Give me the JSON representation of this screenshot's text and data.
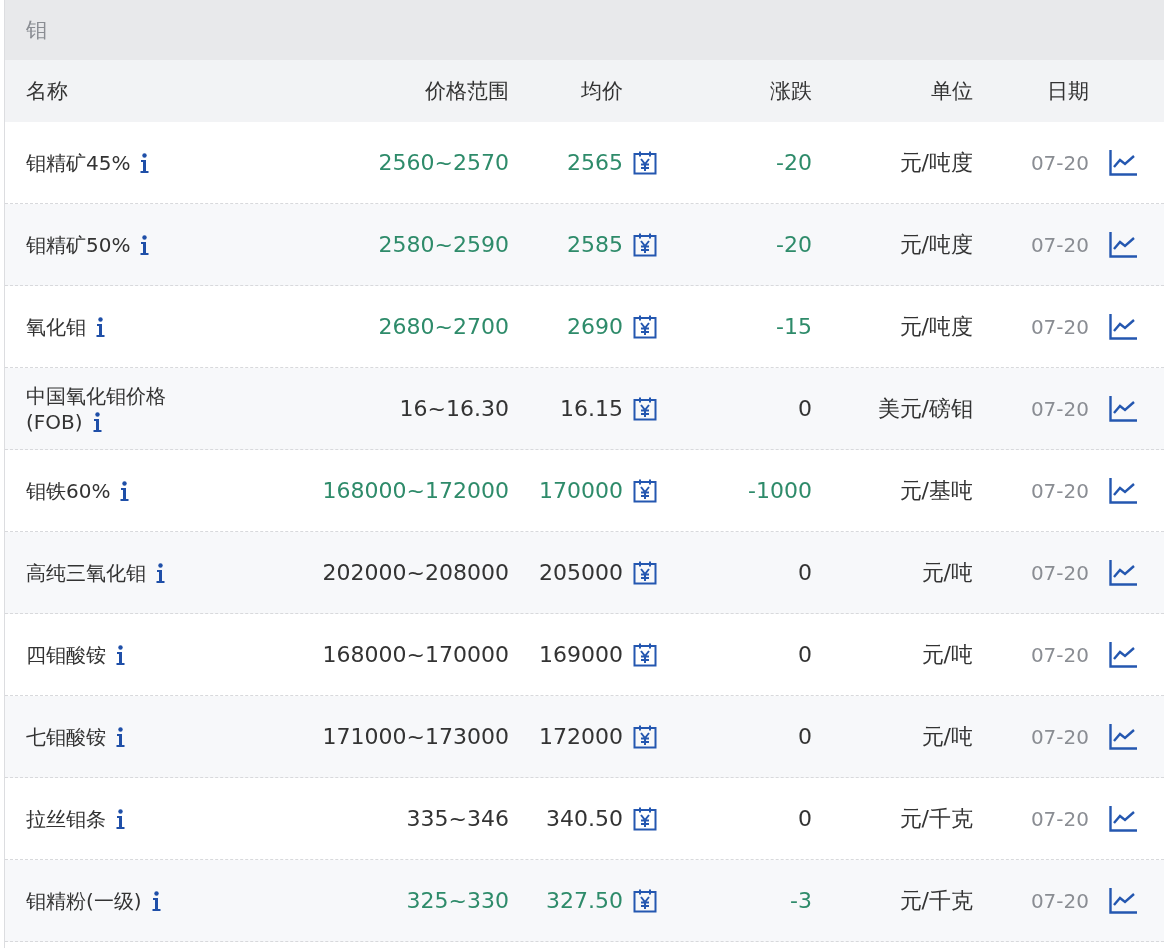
{
  "panel": {
    "title": "钼"
  },
  "table": {
    "columns": [
      "名称",
      "价格范围",
      "均价",
      "涨跌",
      "单位",
      "日期"
    ],
    "rows": [
      {
        "name": "钼精矿45%",
        "range": "2560~2570",
        "avg": "2565",
        "change": "-20",
        "kind": "down",
        "unit": "元/吨度",
        "date": "07-20"
      },
      {
        "name": "钼精矿50%",
        "range": "2580~2590",
        "avg": "2585",
        "change": "-20",
        "kind": "down",
        "unit": "元/吨度",
        "date": "07-20"
      },
      {
        "name": "氧化钼",
        "range": "2680~2700",
        "avg": "2690",
        "change": "-15",
        "kind": "down",
        "unit": "元/吨度",
        "date": "07-20"
      },
      {
        "name": "中国氧化钼价格(FOB)",
        "range": "16~16.30",
        "avg": "16.15",
        "change": "0",
        "kind": "flat",
        "unit": "美元/磅钼",
        "date": "07-20"
      },
      {
        "name": "钼铁60%",
        "range": "168000~172000",
        "avg": "170000",
        "change": "-1000",
        "kind": "down",
        "unit": "元/基吨",
        "date": "07-20"
      },
      {
        "name": "高纯三氧化钼",
        "range": "202000~208000",
        "avg": "205000",
        "change": "0",
        "kind": "flat",
        "unit": "元/吨",
        "date": "07-20"
      },
      {
        "name": "四钼酸铵",
        "range": "168000~170000",
        "avg": "169000",
        "change": "0",
        "kind": "flat",
        "unit": "元/吨",
        "date": "07-20"
      },
      {
        "name": "七钼酸铵",
        "range": "171000~173000",
        "avg": "172000",
        "change": "0",
        "kind": "flat",
        "unit": "元/吨",
        "date": "07-20"
      },
      {
        "name": "拉丝钼条",
        "range": "335~346",
        "avg": "340.50",
        "change": "0",
        "kind": "flat",
        "unit": "元/千克",
        "date": "07-20"
      },
      {
        "name": "钼精粉(一级)",
        "range": "325~330",
        "avg": "327.50",
        "change": "-3",
        "kind": "down",
        "unit": "元/千克",
        "date": "07-20"
      }
    ]
  }
}
